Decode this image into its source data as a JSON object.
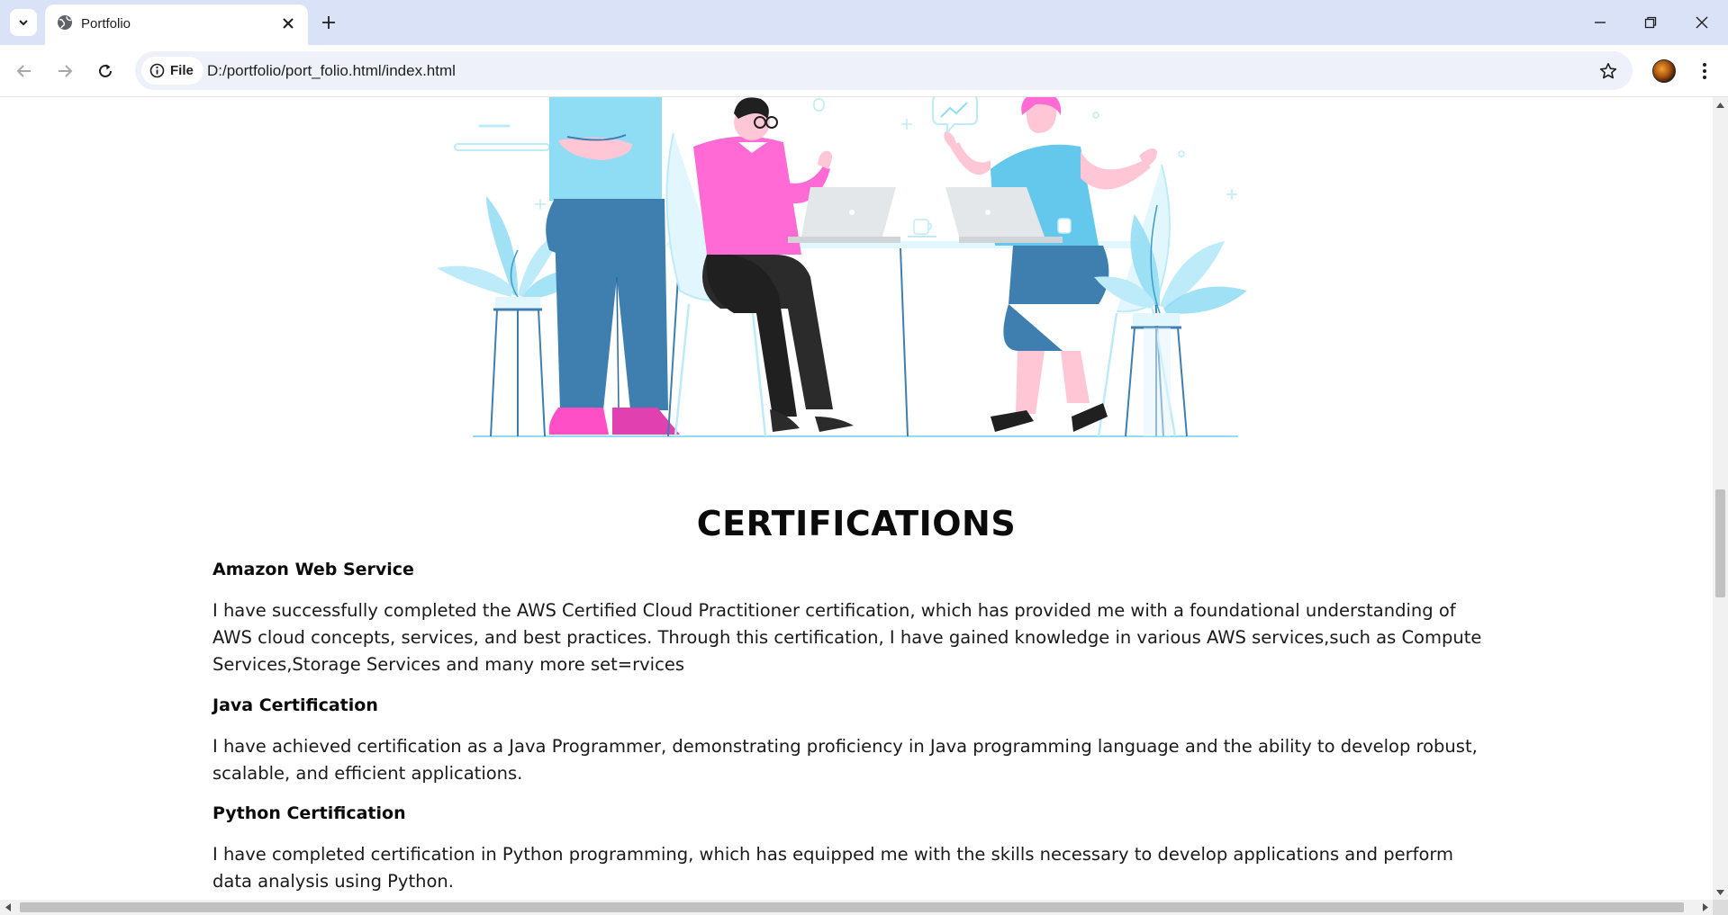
{
  "browser": {
    "tab_title": "Portfolio",
    "chip_label": "File",
    "url": "D:/portfolio/port_folio.html/index.html"
  },
  "page": {
    "certifications_title": "CERTIFICATIONS",
    "certifications": [
      {
        "heading": "Amazon Web Service",
        "text": "I have successfully completed the AWS Certified Cloud Practitioner certification, which has provided me with a foundational understanding of AWS cloud concepts, services, and best practices. Through this certification, I have gained knowledge in various AWS services,such as Compute Services,Storage Services and many more set=rvices"
      },
      {
        "heading": "Java Certification",
        "text": "I have achieved certification as a Java Programmer, demonstrating proficiency in Java programming language and the ability to develop robust, scalable, and efficient applications."
      },
      {
        "heading": "Python Certification",
        "text": "I have completed certification in Python programming, which has equipped me with the skills necessary to develop applications and perform data analysis using Python."
      }
    ]
  },
  "colors": {
    "tabstrip": "#dae2f8",
    "omnibox": "#eef1f9",
    "illustration_blue": "#3f7fb0",
    "illustration_pink": "#ff6ad5",
    "illustration_light_blue": "#8fdcf5"
  }
}
